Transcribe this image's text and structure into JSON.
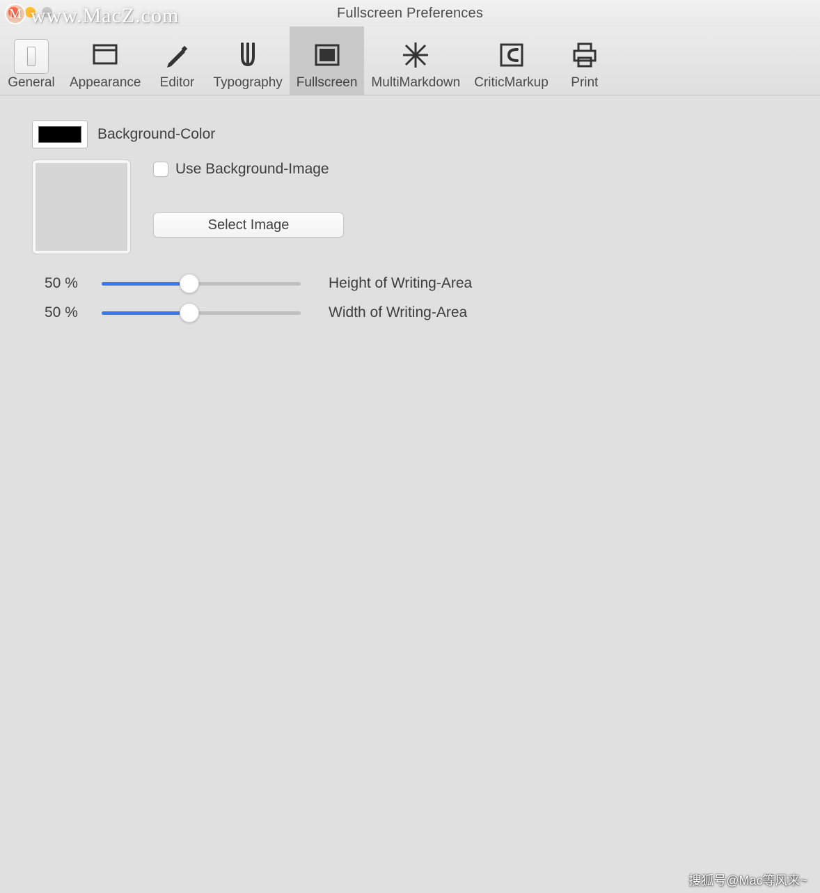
{
  "window": {
    "title": "Fullscreen Preferences"
  },
  "toolbar": {
    "items": [
      {
        "label": "General"
      },
      {
        "label": "Appearance"
      },
      {
        "label": "Editor"
      },
      {
        "label": "Typography"
      },
      {
        "label": "Fullscreen"
      },
      {
        "label": "MultiMarkdown"
      },
      {
        "label": "CriticMarkup"
      },
      {
        "label": "Print"
      }
    ],
    "selected_index": 4
  },
  "content": {
    "background_color_label": "Background-Color",
    "background_color_value": "#000000",
    "use_bg_image_label": "Use Background-Image",
    "use_bg_image_checked": false,
    "select_image_button": "Select Image",
    "sliders": {
      "height": {
        "value_text": "50 %",
        "value": 50,
        "label": "Height of Writing-Area"
      },
      "width": {
        "value_text": "50 %",
        "value": 50,
        "label": "Width of Writing-Area"
      }
    }
  },
  "watermark": {
    "top_text": "www.MacZ.com",
    "logo_letter": "M",
    "footer_text": "搜狐号@Mac等风来~"
  }
}
